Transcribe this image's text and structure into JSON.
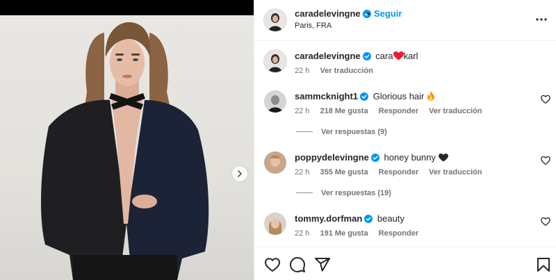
{
  "post": {
    "username": "caradelevingne",
    "follow_label": "Seguir",
    "separator": "•",
    "location": "Paris, FRA"
  },
  "caption": {
    "username": "caradelevingne",
    "text_before": "cara",
    "text_after": "karl",
    "time": "22 h",
    "translate": "Ver traducción"
  },
  "comments": [
    {
      "username": "sammcknight1",
      "text": "Glorious hair",
      "emoji": "fire-emoji",
      "time": "22 h",
      "likes": "218 Me gusta",
      "reply": "Responder",
      "translate": "Ver traducción",
      "view_replies": "Ver respuestas (9)"
    },
    {
      "username": "poppydelevingne",
      "text": "honey bunny",
      "emoji": "black-heart-emoji",
      "time": "22 h",
      "likes": "355 Me gusta",
      "reply": "Responder",
      "translate": "Ver traducción",
      "view_replies": "Ver respuestas (19)"
    },
    {
      "username": "tommy.dorfman",
      "text": "beauty",
      "time": "22 h",
      "likes": "191 Me gusta",
      "reply": "Responder"
    }
  ],
  "colors": {
    "link_blue": "#0095f6",
    "verified_blue": "#0095f6",
    "text": "#262626",
    "muted": "#737373",
    "heart_red": "#ed1c2e"
  },
  "icons": [
    "verified-icon",
    "more-options-icon",
    "like-icon",
    "comment-icon",
    "share-icon",
    "save-icon",
    "next-arrow-icon"
  ]
}
